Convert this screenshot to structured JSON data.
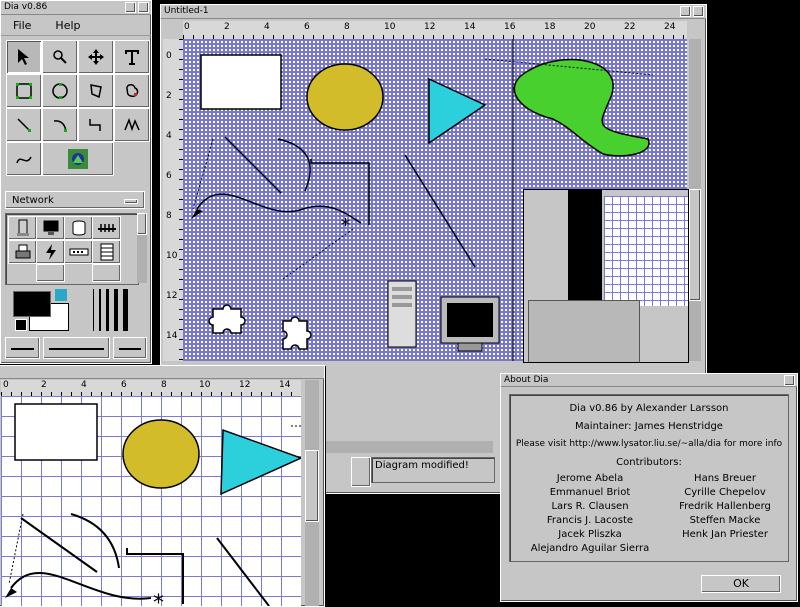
{
  "toolbox": {
    "title": "Dia v0.86",
    "menu": {
      "file": "File",
      "help": "Help"
    },
    "sheet_selector": "Network"
  },
  "diagram": {
    "title": "Untitled-1",
    "ruler_top": [
      "0",
      "2",
      "4",
      "6",
      "8",
      "10",
      "12",
      "14",
      "16",
      "18",
      "20",
      "22",
      "24"
    ],
    "ruler_left": [
      "0",
      "2",
      "4",
      "6",
      "8",
      "10",
      "12",
      "14"
    ],
    "status": "Diagram modified!"
  },
  "second_view": {
    "ruler_top": [
      "0",
      "2",
      "4",
      "6",
      "8",
      "10",
      "12",
      "14"
    ]
  },
  "about": {
    "title": "About Dia",
    "version_line": "Dia v0.86 by Alexander Larsson",
    "maintainer_line": "Maintainer: James Henstridge",
    "visit_line": "Please visit http://www.lysator.liu.se/~alla/dia for more info",
    "contributors_heading": "Contributors:",
    "contributors_left": [
      "Jerome Abela",
      "Emmanuel Briot",
      "Lars R. Clausen",
      "Francis J. Lacoste",
      "Jacek Pliszka",
      "Alejandro Aguilar Sierra"
    ],
    "contributors_right": [
      "Hans Breuer",
      "Cyrille Chepelov",
      "Fredrik Hallenberg",
      "Steffen Macke",
      "Henk Jan Priester"
    ],
    "ok_label": "OK"
  },
  "colors": {
    "ellipse": "#d2bc2a",
    "triangle": "#2ccfdc",
    "blob": "#48d02e",
    "grid": "#7b7bd6"
  }
}
